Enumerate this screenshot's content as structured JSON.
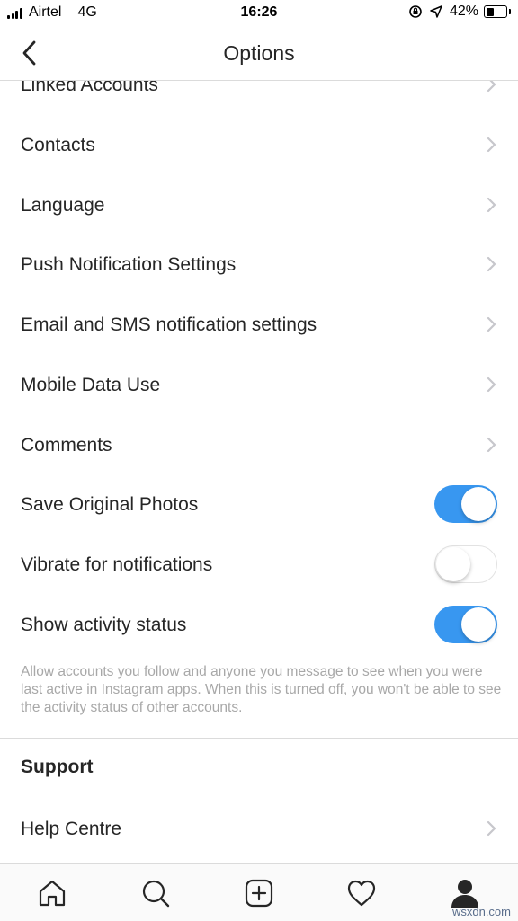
{
  "status_bar": {
    "carrier": "Airtel",
    "network": "4G",
    "time": "16:26",
    "battery": "42%",
    "battery_level": 0.42
  },
  "nav": {
    "title": "Options",
    "back_icon": "chevron-left-icon"
  },
  "settings": {
    "linked_accounts": "Linked Accounts",
    "contacts": "Contacts",
    "language": "Language",
    "push_notification_settings": "Push Notification Settings",
    "email_sms_settings": "Email and SMS notification settings",
    "mobile_data_use": "Mobile Data Use",
    "comments": "Comments",
    "save_original_photos": {
      "label": "Save Original Photos",
      "on": true
    },
    "vibrate_for_notifications": {
      "label": "Vibrate for notifications",
      "on": false
    },
    "show_activity_status": {
      "label": "Show activity status",
      "on": true
    },
    "activity_status_help": "Allow accounts you follow and anyone you message to see when you were last active in Instagram apps. When this is turned off, you won't be able to see the activity status of other accounts."
  },
  "support": {
    "header": "Support",
    "help_centre": "Help Centre"
  },
  "tab_bar": {
    "tabs": [
      "home-icon",
      "search-icon",
      "new-post-icon",
      "activity-heart-icon",
      "profile-icon"
    ]
  },
  "watermark": "wsxdn.com",
  "colors": {
    "toggle_on": "#3897f0",
    "text": "#262626",
    "secondary_text": "#a8a8a8",
    "divider": "#dbdbdb"
  }
}
